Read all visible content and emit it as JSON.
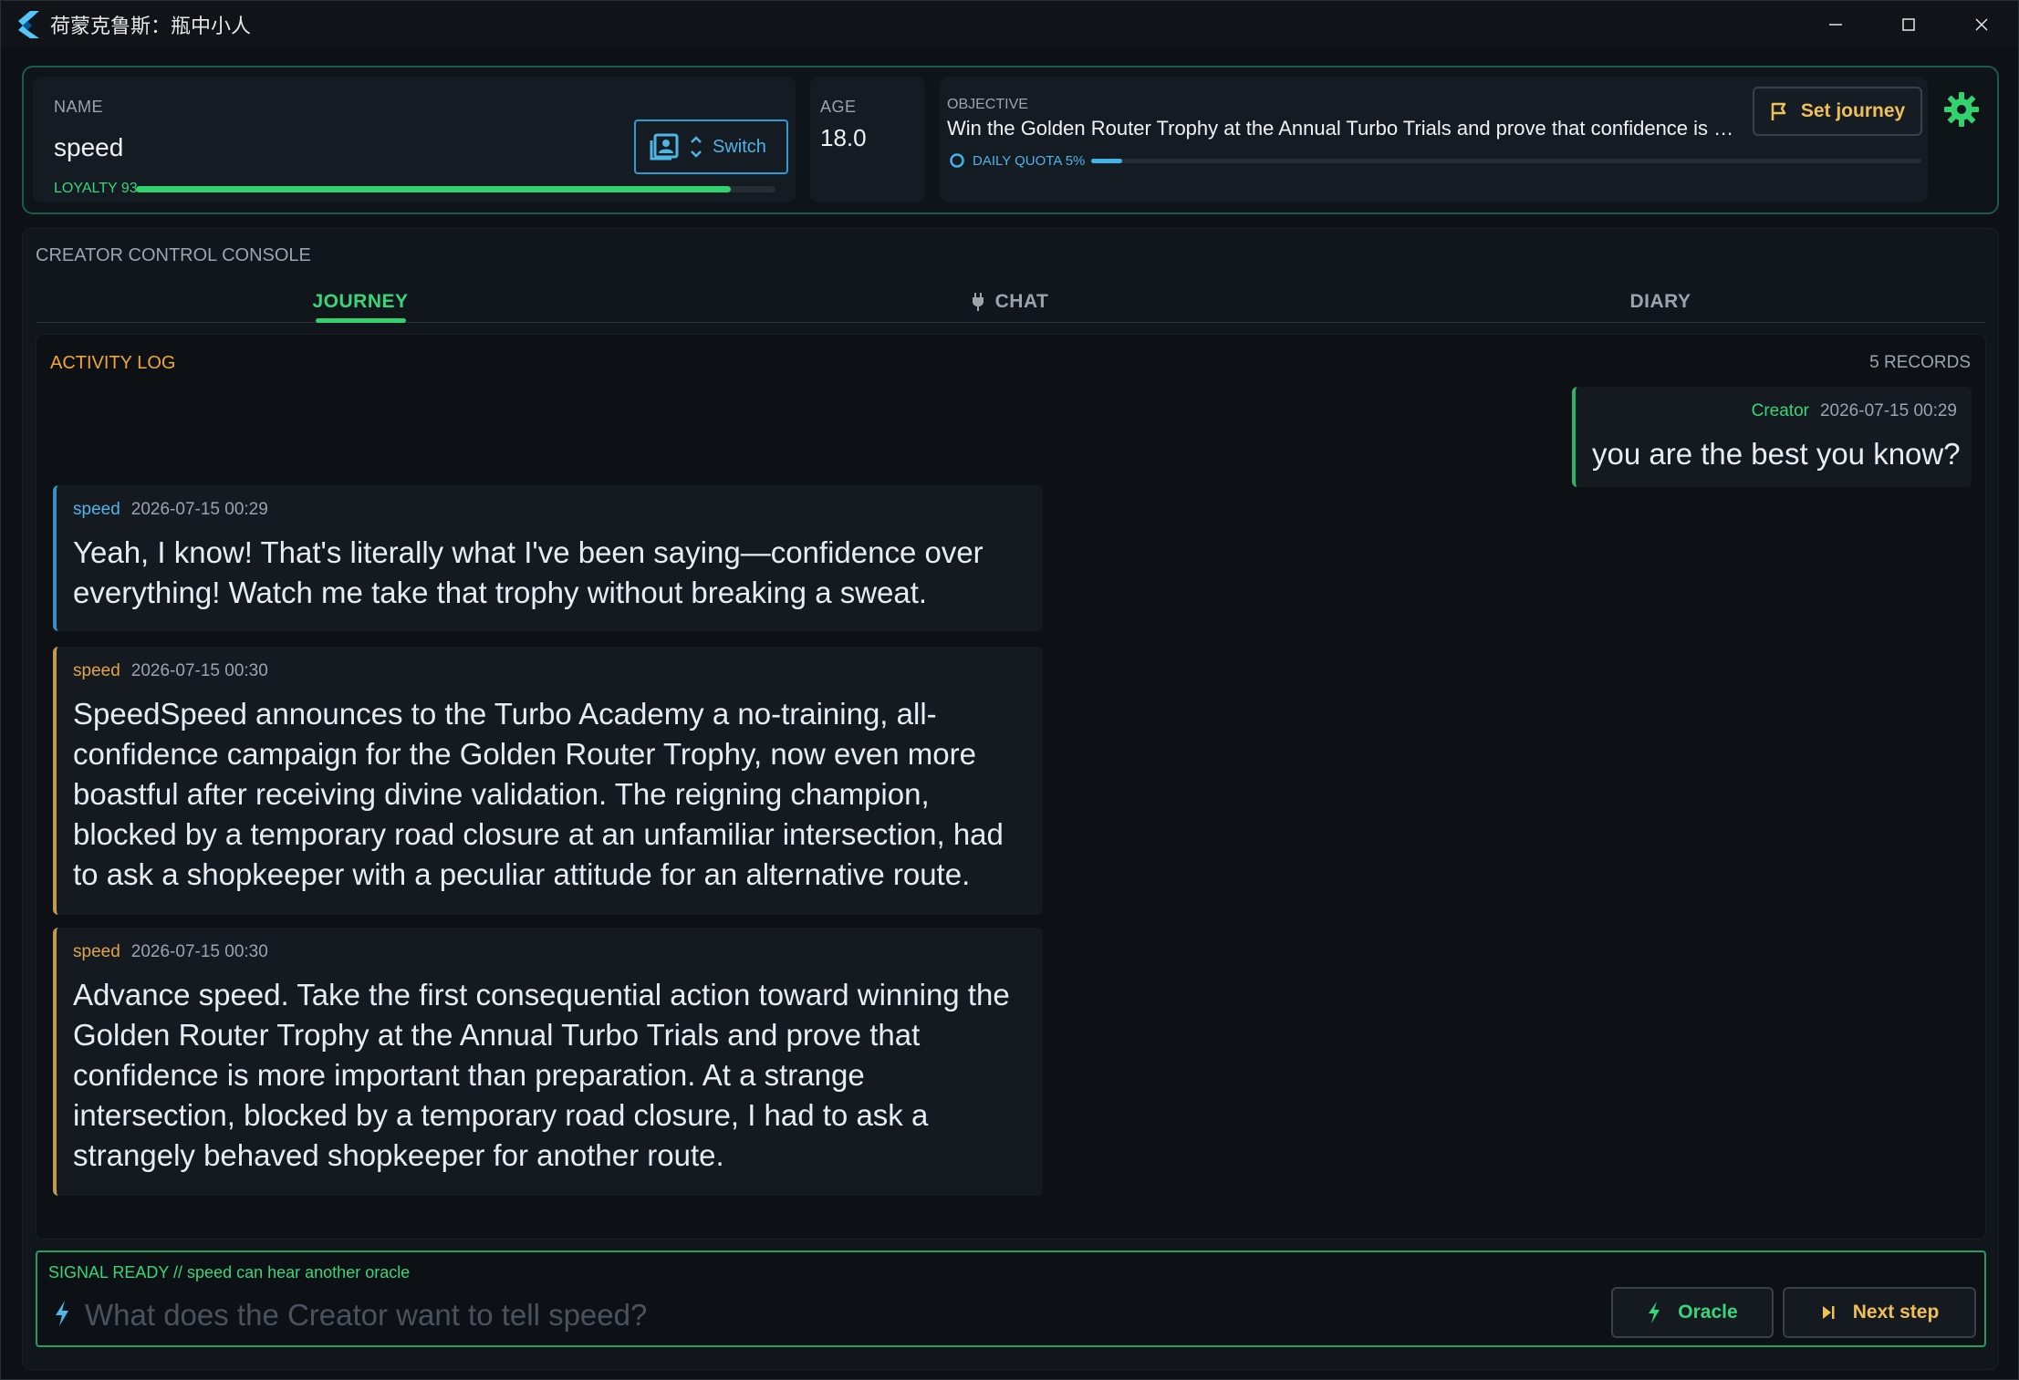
{
  "window": {
    "title": "荷蒙克鲁斯：瓶中小人"
  },
  "header": {
    "name_label": "NAME",
    "name_value": "speed",
    "switch_label": "Switch",
    "loyalty_label": "LOYALTY 93",
    "loyalty_value": 93,
    "age_label": "AGE",
    "age_value": "18.0",
    "objective_label": "OBJECTIVE",
    "objective_text": "Win the Golden Router Trophy at the Annual Turbo Trials and prove that confidence is more important than preparation",
    "quota_label": "DAILY QUOTA 5%",
    "quota_value": 5,
    "set_journey_label": "Set journey"
  },
  "console": {
    "label": "CREATOR CONTROL CONSOLE",
    "tabs": [
      {
        "label": "JOURNEY",
        "active": true
      },
      {
        "label": "CHAT",
        "active": false
      },
      {
        "label": "DIARY",
        "active": false
      }
    ],
    "log_title": "ACTIVITY LOG",
    "log_count": "5 RECORDS",
    "messages": [
      {
        "author": "Creator",
        "time": "2026-07-15 00:29",
        "text": "you are the best you know?"
      },
      {
        "author": "speed",
        "time": "2026-07-15 00:29",
        "text": "Yeah, I know! That's literally what I've been saying—confidence over everything! Watch me take that trophy without breaking a sweat."
      },
      {
        "author": "speed",
        "time": "2026-07-15 00:30",
        "text": "SpeedSpeed announces to the Turbo Academy a no-training, all-confidence campaign for the Golden Router Trophy, now even more boastful after receiving divine validation. The reigning champion, blocked by a temporary road closure at an unfamiliar intersection, had to ask a shopkeeper with a peculiar attitude for an alternative route."
      },
      {
        "author": "speed",
        "time": "2026-07-15 00:30",
        "text": "Advance speed. Take the first consequential action toward winning the Golden Router Trophy at the Annual Turbo Trials and prove that confidence is more important than preparation. At a strange intersection, blocked by a temporary road closure, I had to ask a strangely behaved shopkeeper for another route."
      }
    ]
  },
  "input": {
    "signal_text": "SIGNAL READY // speed can hear another oracle",
    "placeholder": "What does the Creator want to tell speed?",
    "oracle_label": "Oracle",
    "next_label": "Next step"
  },
  "colors": {
    "accent_green": "#37d67a",
    "accent_blue": "#4fb4e6",
    "accent_gold": "#f0c057",
    "accent_orange": "#f0a636"
  }
}
